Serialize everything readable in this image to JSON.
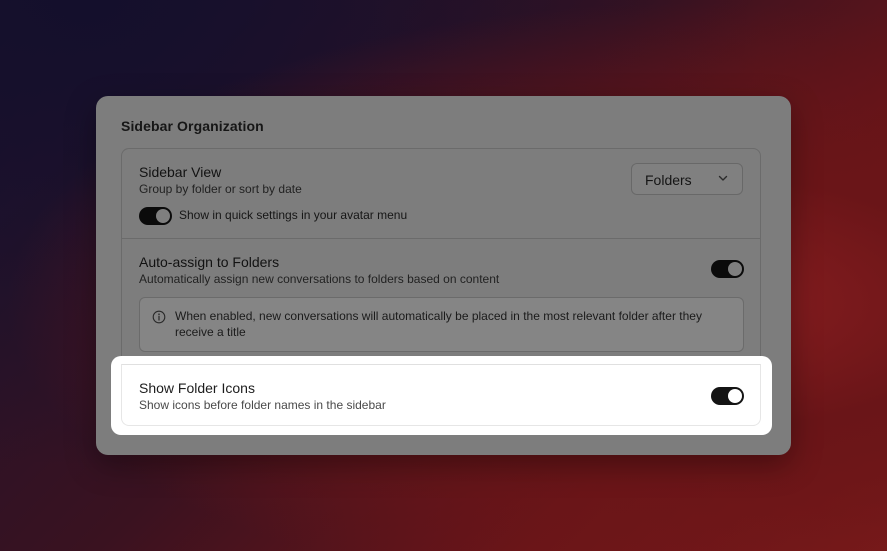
{
  "section": {
    "title": "Sidebar Organization"
  },
  "sidebar_view": {
    "title": "Sidebar View",
    "description": "Group by folder or sort by date",
    "dropdown": {
      "selected": "Folders",
      "icon": "chevron-down-icon"
    },
    "quick_settings": {
      "label": "Show in quick settings in your avatar menu",
      "enabled": true
    }
  },
  "auto_assign": {
    "title": "Auto-assign to Folders",
    "description": "Automatically assign new conversations to folders based on content",
    "enabled": true,
    "info": {
      "icon": "info-icon",
      "text": "When enabled, new conversations will automatically be placed in the most relevant folder after they receive a title"
    }
  },
  "folder_icons": {
    "title": "Show Folder Icons",
    "description": "Show icons before folder names in the sidebar",
    "enabled": true
  }
}
